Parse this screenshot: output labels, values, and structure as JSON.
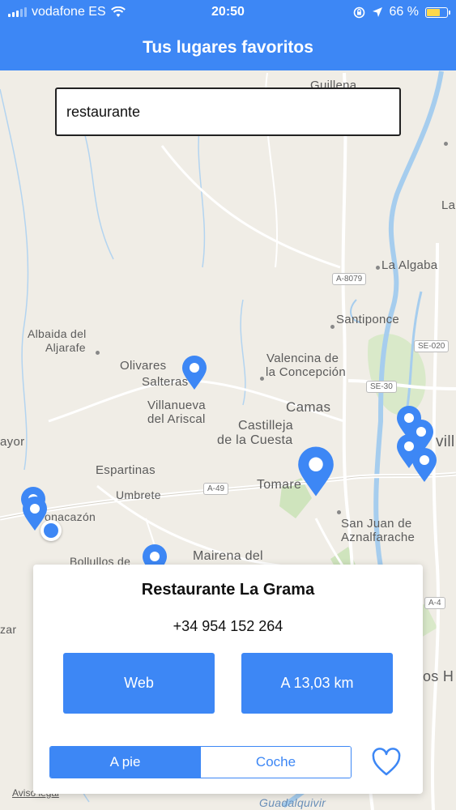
{
  "status_bar": {
    "carrier": "vodafone ES",
    "time": "20:50",
    "battery_percent": "66 %",
    "battery_level": 0.66,
    "icons": [
      "signal-icon",
      "wifi-icon",
      "rotation-lock-icon",
      "location-arrow-icon",
      "battery-icon"
    ]
  },
  "header": {
    "title": "Tus lugares favoritos"
  },
  "search": {
    "value": "restaurante"
  },
  "map": {
    "places": {
      "guillena": "Guillena",
      "algaba": "La Algaba",
      "santiponce": "Santiponce",
      "albaida1": "Albaida del",
      "albaida2": "Aljarafe",
      "olivares": "Olivares",
      "salteras": "Salteras",
      "valencina1": "Valencina de",
      "valencina2": "la Concepción",
      "villanueva1": "Villanueva",
      "villanueva2": "del Ariscal",
      "camas": "Camas",
      "castilleja1": "Castilleja",
      "castilleja2": "de la Cuesta",
      "mayor": "ayor",
      "espartinas": "Espartinas",
      "umbrete": "Umbrete",
      "tomares": "Tomare",
      "bonacazon": "onacazón",
      "sanjuan1": "San Juan de",
      "sanjuan2": "Aznalfarache",
      "bollullos": "Bollullos de",
      "mairena": "Mairena del",
      "zar": "zar",
      "sevilla": "vill",
      "dos_h": "os H",
      "guadalquivir": "Guadalquivir",
      "la": "La"
    },
    "roads": {
      "a8079": "A-8079",
      "se020": "SE-020",
      "se30": "SE-30",
      "a49": "A-49",
      "a4": "A-4"
    },
    "legal_link": "Aviso legal"
  },
  "card": {
    "title": "Restaurante La Grama",
    "phone": "+34 954 152 264",
    "web_button": "Web",
    "distance_button": "A 13,03 km",
    "mode_walk": "A pie",
    "mode_car": "Coche",
    "selected_mode": "A pie"
  },
  "colors": {
    "accent": "#3d87f5"
  }
}
